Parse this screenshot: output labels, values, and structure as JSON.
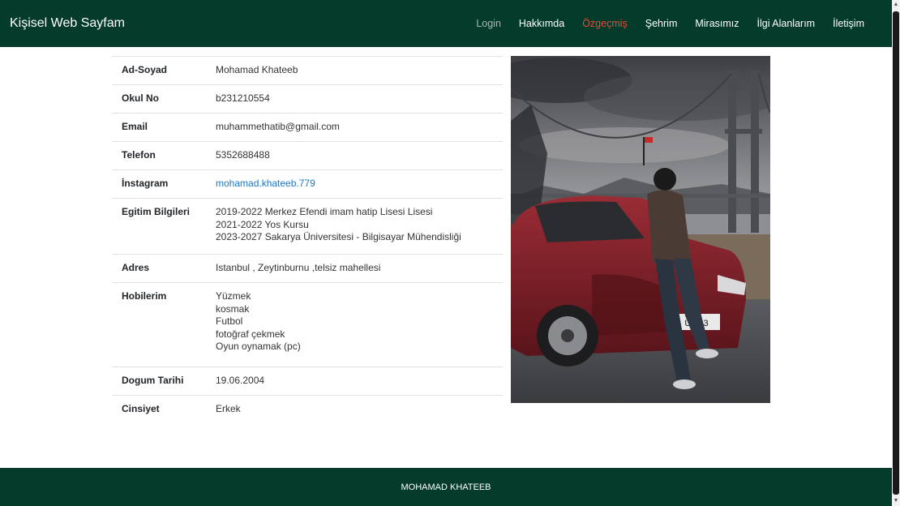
{
  "navbar": {
    "brand": "Kişisel Web Sayfam",
    "links": [
      {
        "label": "Login",
        "state": "muted"
      },
      {
        "label": "Hakkımda",
        "state": "normal"
      },
      {
        "label": "Özgeçmiş",
        "state": "active"
      },
      {
        "label": "Şehrim",
        "state": "normal"
      },
      {
        "label": "Mirasımız",
        "state": "normal"
      },
      {
        "label": "İlgi Alanlarım",
        "state": "normal"
      },
      {
        "label": "İletişim",
        "state": "normal"
      }
    ]
  },
  "profile": {
    "rows": [
      {
        "key": "Ad-Soyad",
        "value": "Mohamad Khateeb"
      },
      {
        "key": "Okul No",
        "value": "b231210554"
      },
      {
        "key": "Email",
        "value": "muhammethatib@gmail.com"
      },
      {
        "key": "Telefon",
        "value": "5352688488"
      },
      {
        "key": "İnstagram",
        "value": "mohamad.khateeb.779"
      },
      {
        "key": "Egitim Bilgileri",
        "lines": [
          "2019-2022 Merkez Efendi imam hatip Lisesi Lisesi",
          "2021-2022 Yos Kursu",
          "2023-2027 Sakarya Üniversitesi - Bilgisayar Mühendisliği"
        ]
      },
      {
        "key": "Adres",
        "value": "Istanbul , Zeytinburnu ,telsiz mahellesi"
      },
      {
        "key": "Hobilerim",
        "lines": [
          "Yüzmek",
          "kosmak",
          "Futbol",
          "fotoğraf çekmek",
          "Oyun oynamak (pc)"
        ]
      },
      {
        "key": "Dogum Tarihi",
        "value": "19.06.2004"
      },
      {
        "key": "Cinsiyet",
        "value": "Erkek"
      }
    ]
  },
  "photo": {
    "plate_text": "U 213"
  },
  "footer": {
    "text": "MOHAMAD KHATEEB"
  },
  "colors": {
    "nav_bg": "#043b2a",
    "active_link": "#e34b3c",
    "link": "#1b77c9",
    "car": "#7d1f27"
  }
}
